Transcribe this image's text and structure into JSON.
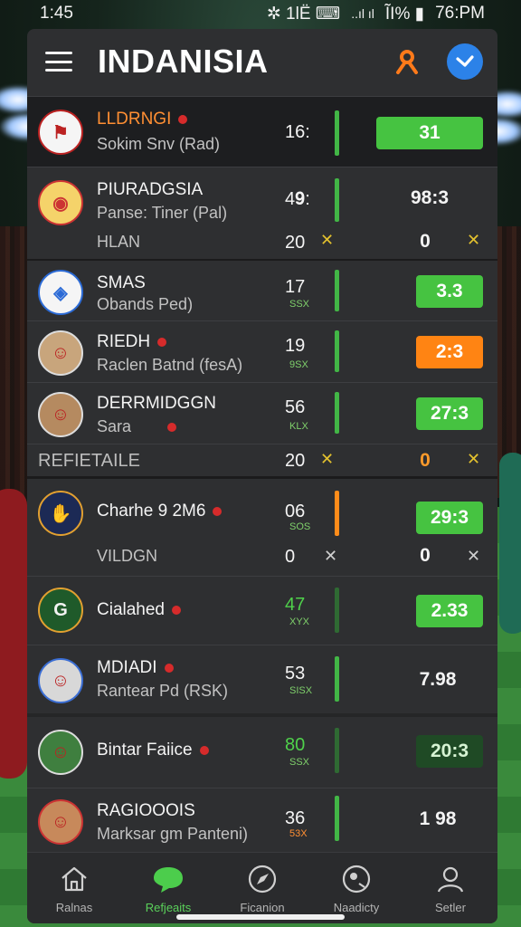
{
  "status": {
    "time": "1:45",
    "icons": "✲ 1lЁ ⌨",
    "signal": "..ıl ıl",
    "battery": "ĨI% ▮",
    "clock": "76:PM"
  },
  "header": {
    "title": "INDANISIA"
  },
  "rows": [
    {
      "name": "LLDRNGI",
      "sub": "Sokim Snv (Rad)",
      "score": "16:",
      "pill": "31"
    },
    {
      "name": "PIURADGSIA",
      "sub": "Panse: Tiner (Pal)",
      "score": "4𝟗:",
      "pill": "98:3"
    },
    {
      "name": "HLAN",
      "score": "20",
      "pill": "0"
    },
    {
      "name": "SMAS",
      "sub": "Obands Ped)",
      "score": "17",
      "mini": "SSX",
      "pill": "3.3"
    },
    {
      "name": "RIEDH",
      "sub": "Raclen Batnd (fesA)",
      "score": "19",
      "mini": "9SX",
      "pill": "2:3"
    },
    {
      "name": "DERRMIDGGN",
      "sub": "Sara",
      "score": "56",
      "mini": "KLX",
      "pill": "27:3"
    },
    {
      "name": "REFIETAILE",
      "score": "20",
      "pill": "0"
    },
    {
      "name": "Charhe 9 2M6",
      "score": "06",
      "mini": "SOS",
      "pill": "29:3"
    },
    {
      "name": "VILDGN",
      "score": "0",
      "pill": "0"
    },
    {
      "name": "Cialahed",
      "score": "47",
      "mini": "XYX",
      "pill": "2.33"
    },
    {
      "name": "MDIADI",
      "sub": "Rantear Pd (RSK)",
      "score": "53",
      "mini": "SISX",
      "pill": "7.98"
    },
    {
      "name": "Bintar Faiice",
      "score": "80",
      "mini": "SSX",
      "pill": "20:3"
    },
    {
      "name": "RAGIOOOIS",
      "sub": "Marksar gm Panteni)",
      "score": "36",
      "mini": "53X",
      "pill": "1 98"
    }
  ],
  "nav": [
    {
      "label": "Ralnas",
      "icon": "home-icon"
    },
    {
      "label": "Refjeaits",
      "icon": "chat-icon"
    },
    {
      "label": "Ficanion",
      "icon": "compass-icon"
    },
    {
      "label": "Naadicty",
      "icon": "ball-icon"
    },
    {
      "label": "Setler",
      "icon": "user-icon"
    }
  ],
  "colors": {
    "accent_green": "#46c341",
    "accent_orange": "#ff8413",
    "accent_blue": "#2c82e8"
  }
}
